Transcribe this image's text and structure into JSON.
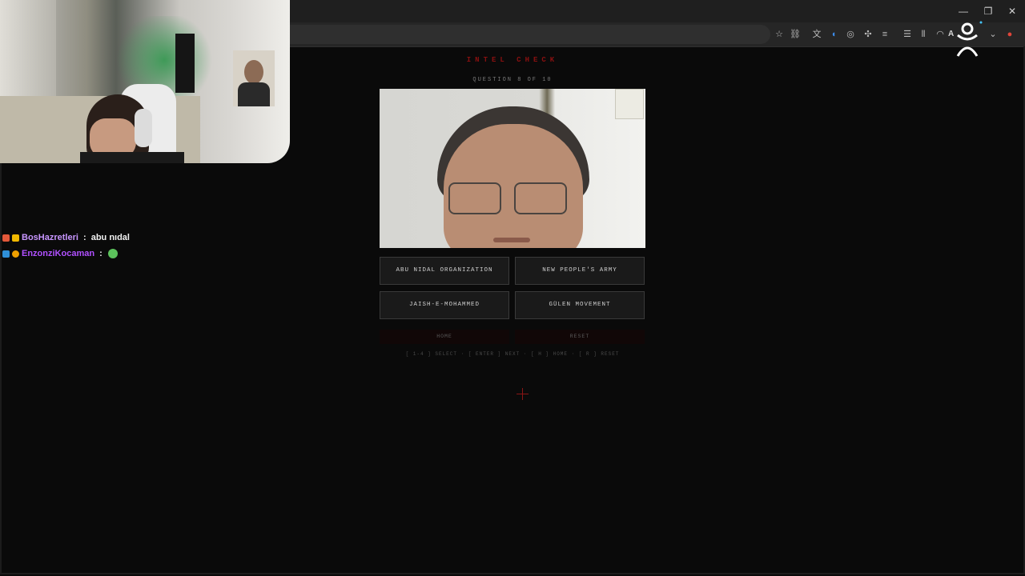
{
  "window": {
    "minimize": "—",
    "restore": "❐",
    "close": "✕"
  },
  "toolbar": {
    "profile_label": "A",
    "icons": [
      "star-icon",
      "link-icon",
      "translate-icon",
      "audio-icon",
      "circle-icon",
      "extensions-icon",
      "reader-icon",
      "menu-icon",
      "waveform-icon",
      "cast-icon",
      "chevron-down-icon",
      "record-icon"
    ]
  },
  "chat": {
    "messages": [
      {
        "username": "BosHazretleri",
        "separator": " : ",
        "text": "abu nıdal",
        "color": "#c896ff"
      },
      {
        "username": "EnzonziKocaman",
        "separator": " :",
        "text": "",
        "color": "#b050ff"
      }
    ]
  },
  "quiz": {
    "title": "INTEL CHECK",
    "progress": "QUESTION 8 OF 10",
    "answers": [
      "ABU NIDAL ORGANIZATION",
      "NEW PEOPLE'S ARMY",
      "JAISH-E-MOHAMMED",
      "GÜLEN MOVEMENT"
    ],
    "home_label": "HOME",
    "reset_label": "RESET",
    "hints": "[ 1-4 ] SELECT · [ ENTER ] NEXT · [ H ] HOME · [ R ] RESET"
  },
  "colors": {
    "accent_red": "#8a1010",
    "background": "#0a0a0a",
    "button_bg": "#1a1a1a"
  }
}
